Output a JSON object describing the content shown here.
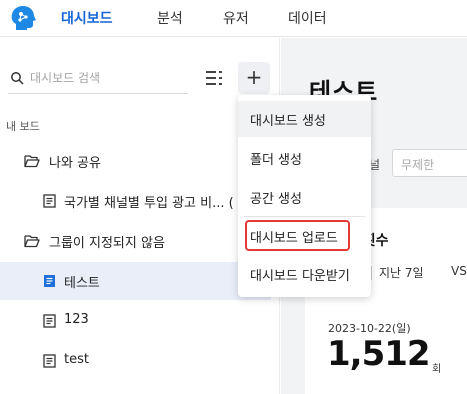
{
  "nav": {
    "logo_icon": "brain-head-logo",
    "items": [
      {
        "label": "대시보드",
        "active": true
      },
      {
        "label": "분석",
        "active": false
      },
      {
        "label": "유저",
        "active": false
      },
      {
        "label": "데이터",
        "active": false
      }
    ],
    "active_color": "#1565d8"
  },
  "sidebar": {
    "search": {
      "placeholder": "대시보드 검색",
      "value": ""
    },
    "section_label": "내 보드",
    "items": [
      {
        "label": "나와 공유",
        "icon": "folder-open-icon"
      },
      {
        "label": "국가별 채널별 투입 광고 비... (",
        "icon": "document-icon"
      },
      {
        "label": "그룹이 지정되지 않음",
        "icon": "folder-open-icon"
      },
      {
        "label": "테스트",
        "icon": "dashboard-document-icon",
        "selected": true
      },
      {
        "label": "123",
        "icon": "document-icon"
      },
      {
        "label": "test",
        "icon": "document-icon"
      }
    ]
  },
  "menu": {
    "items": [
      {
        "label": "대시보드 생성"
      },
      {
        "label": "폴더 생성"
      },
      {
        "label": "공간 생성"
      },
      {
        "label": "대시보드 업로드"
      },
      {
        "label": "대시보드 다운받기"
      }
    ],
    "highlight_color": "#e53935"
  },
  "content": {
    "title": "테스트",
    "filter_label": "널",
    "filter_placeholder": "무제한",
    "card": {
      "title": "등 횟수",
      "period_prefix": "",
      "period_tabs": [
        "지난 7일",
        "VS"
      ],
      "date": "2023-10-22(일)",
      "value": "1,512",
      "unit": "회"
    }
  }
}
